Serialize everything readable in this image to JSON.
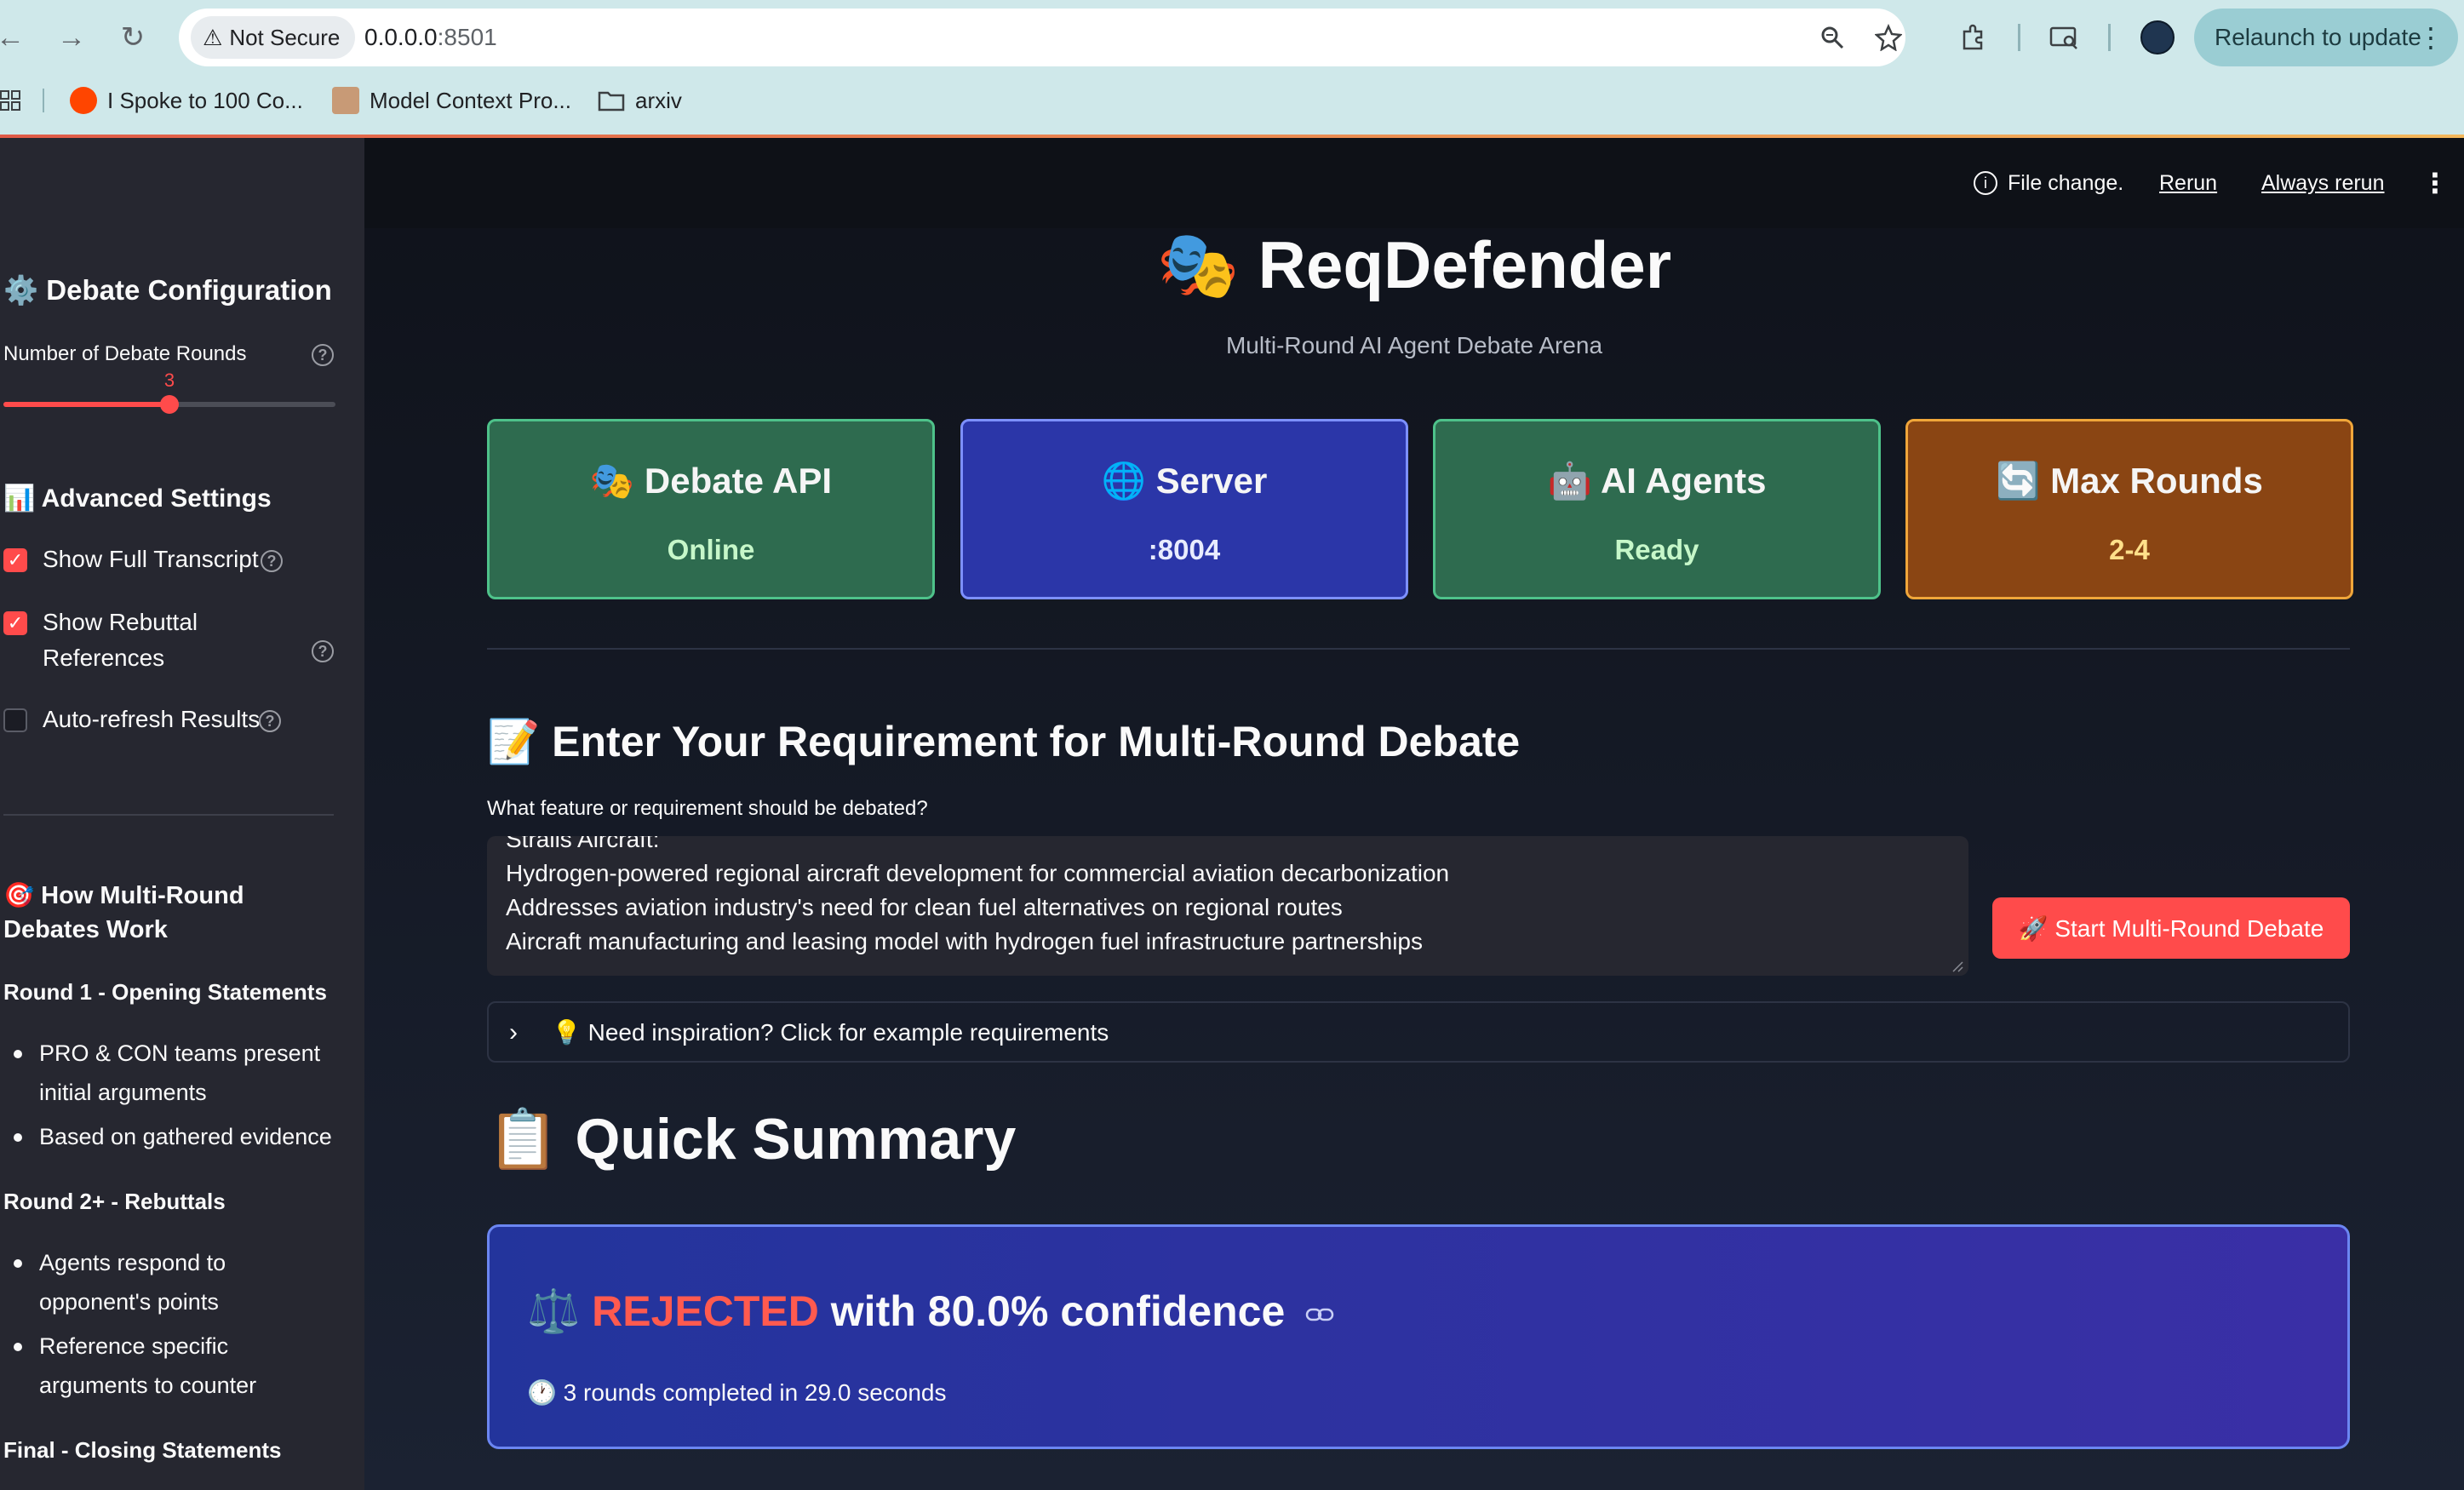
{
  "browser": {
    "security_label": "Not Secure",
    "url_host": "0.0.0.0",
    "url_port": ":8501",
    "relaunch_label": "Relaunch to update",
    "bookmarks": [
      {
        "label": "I Spoke to 100 Co...",
        "icon": "reddit-icon"
      },
      {
        "label": "Model Context Pro...",
        "icon": "avatar-icon"
      },
      {
        "label": "arxiv",
        "icon": "folder-icon"
      }
    ]
  },
  "topbar": {
    "file_change": "File change.",
    "rerun": "Rerun",
    "always_rerun": "Always rerun"
  },
  "sidebar": {
    "config_heading": "⚙️ Debate Configuration",
    "rounds_label": "Number of Debate Rounds",
    "rounds_value": "3",
    "rounds_min": 1,
    "rounds_max": 5,
    "advanced_heading": "📊 Advanced Settings",
    "checkboxes": [
      {
        "label": "Show Full Transcript",
        "checked": true
      },
      {
        "label": "Show Rebuttal References",
        "checked": true
      },
      {
        "label": "Auto-refresh Results",
        "checked": false
      }
    ],
    "how_heading": "🎯 How Multi-Round Debates Work",
    "sections": [
      {
        "title": "Round 1 - Opening Statements",
        "bullets": [
          "PRO & CON teams present initial arguments",
          "Based on gathered evidence"
        ]
      },
      {
        "title": "Round 2+ - Rebuttals",
        "bullets": [
          "Agents respond to opponent's points",
          "Reference specific arguments to counter"
        ]
      },
      {
        "title": "Final - Closing Statements",
        "bullets": []
      }
    ]
  },
  "header": {
    "title": "🎭 ReqDefender",
    "subtitle": "Multi-Round AI Agent Debate Arena"
  },
  "status_cards": [
    {
      "label": "🎭 Debate API",
      "value": "Online",
      "bg": "#2e6b4f",
      "border": "#4ec28a",
      "value_color": "#c6f7c9"
    },
    {
      "label": "🌐 Server",
      "value": ":8004",
      "bg": "#2b36a8",
      "border": "#7d90ff",
      "value_color": "#e8ecff"
    },
    {
      "label": "🤖 AI Agents",
      "value": "Ready",
      "bg": "#2e6b4f",
      "border": "#4ec28a",
      "value_color": "#c6f7c9"
    },
    {
      "label": "🔄 Max Rounds",
      "value": "2-4",
      "bg": "#8a4513",
      "border": "#f0a63a",
      "value_color": "#ffe08a"
    }
  ],
  "requirement": {
    "heading": "📝 Enter Your Requirement for Multi-Round Debate",
    "label": "What feature or requirement should be debated?",
    "lines": [
      "Stralis Aircraft:",
      "Hydrogen-powered regional aircraft development for commercial aviation decarbonization",
      "Addresses aviation industry's need for clean fuel alternatives on regional routes",
      "Aircraft manufacturing and leasing model with hydrogen fuel infrastructure partnerships"
    ],
    "start_button": "🚀 Start Multi-Round Debate",
    "inspiration": "💡 Need inspiration? Click for example requirements"
  },
  "summary": {
    "heading": "📋 Quick Summary",
    "verdict_prefix": "⚖️ ",
    "verdict_word": "REJECTED",
    "verdict_suffix": " with 80.0% confidence",
    "rounds_text": "🕐 3 rounds completed in 29.0 seconds"
  },
  "colors": {
    "accent": "#ff4b4b",
    "sidebar_bg": "#262730",
    "app_bg": "#0e1117"
  }
}
